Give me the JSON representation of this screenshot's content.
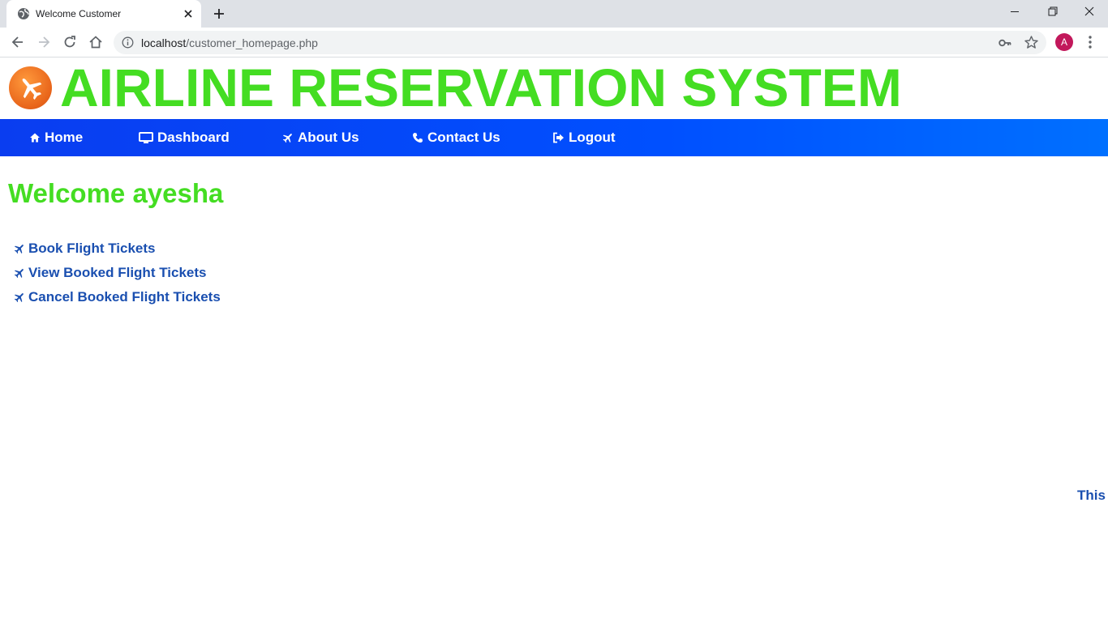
{
  "browser": {
    "tab_title": "Welcome Customer",
    "url_host": "localhost",
    "url_path": "/customer_homepage.php",
    "profile_initial": "A"
  },
  "header": {
    "title": "AIRLINE RESERVATION SYSTEM",
    "logo_icon": "airplane-logo-icon"
  },
  "nav": {
    "items": [
      {
        "label": "Home",
        "icon": "home-icon"
      },
      {
        "label": "Dashboard",
        "icon": "monitor-icon"
      },
      {
        "label": "About Us",
        "icon": "plane-icon"
      },
      {
        "label": "Contact Us",
        "icon": "phone-icon"
      },
      {
        "label": "Logout",
        "icon": "logout-icon"
      }
    ]
  },
  "main": {
    "welcome": "Welcome ayesha",
    "links": [
      {
        "label": "Book Flight Tickets",
        "icon": "plane-icon"
      },
      {
        "label": "View Booked Flight Tickets",
        "icon": "plane-icon"
      },
      {
        "label": "Cancel Booked Flight Tickets",
        "icon": "plane-icon"
      }
    ],
    "marquee": "This"
  },
  "colors": {
    "title_green": "#44dd22",
    "nav_blue": "#0050ff",
    "link_blue": "#1a4fb0"
  }
}
